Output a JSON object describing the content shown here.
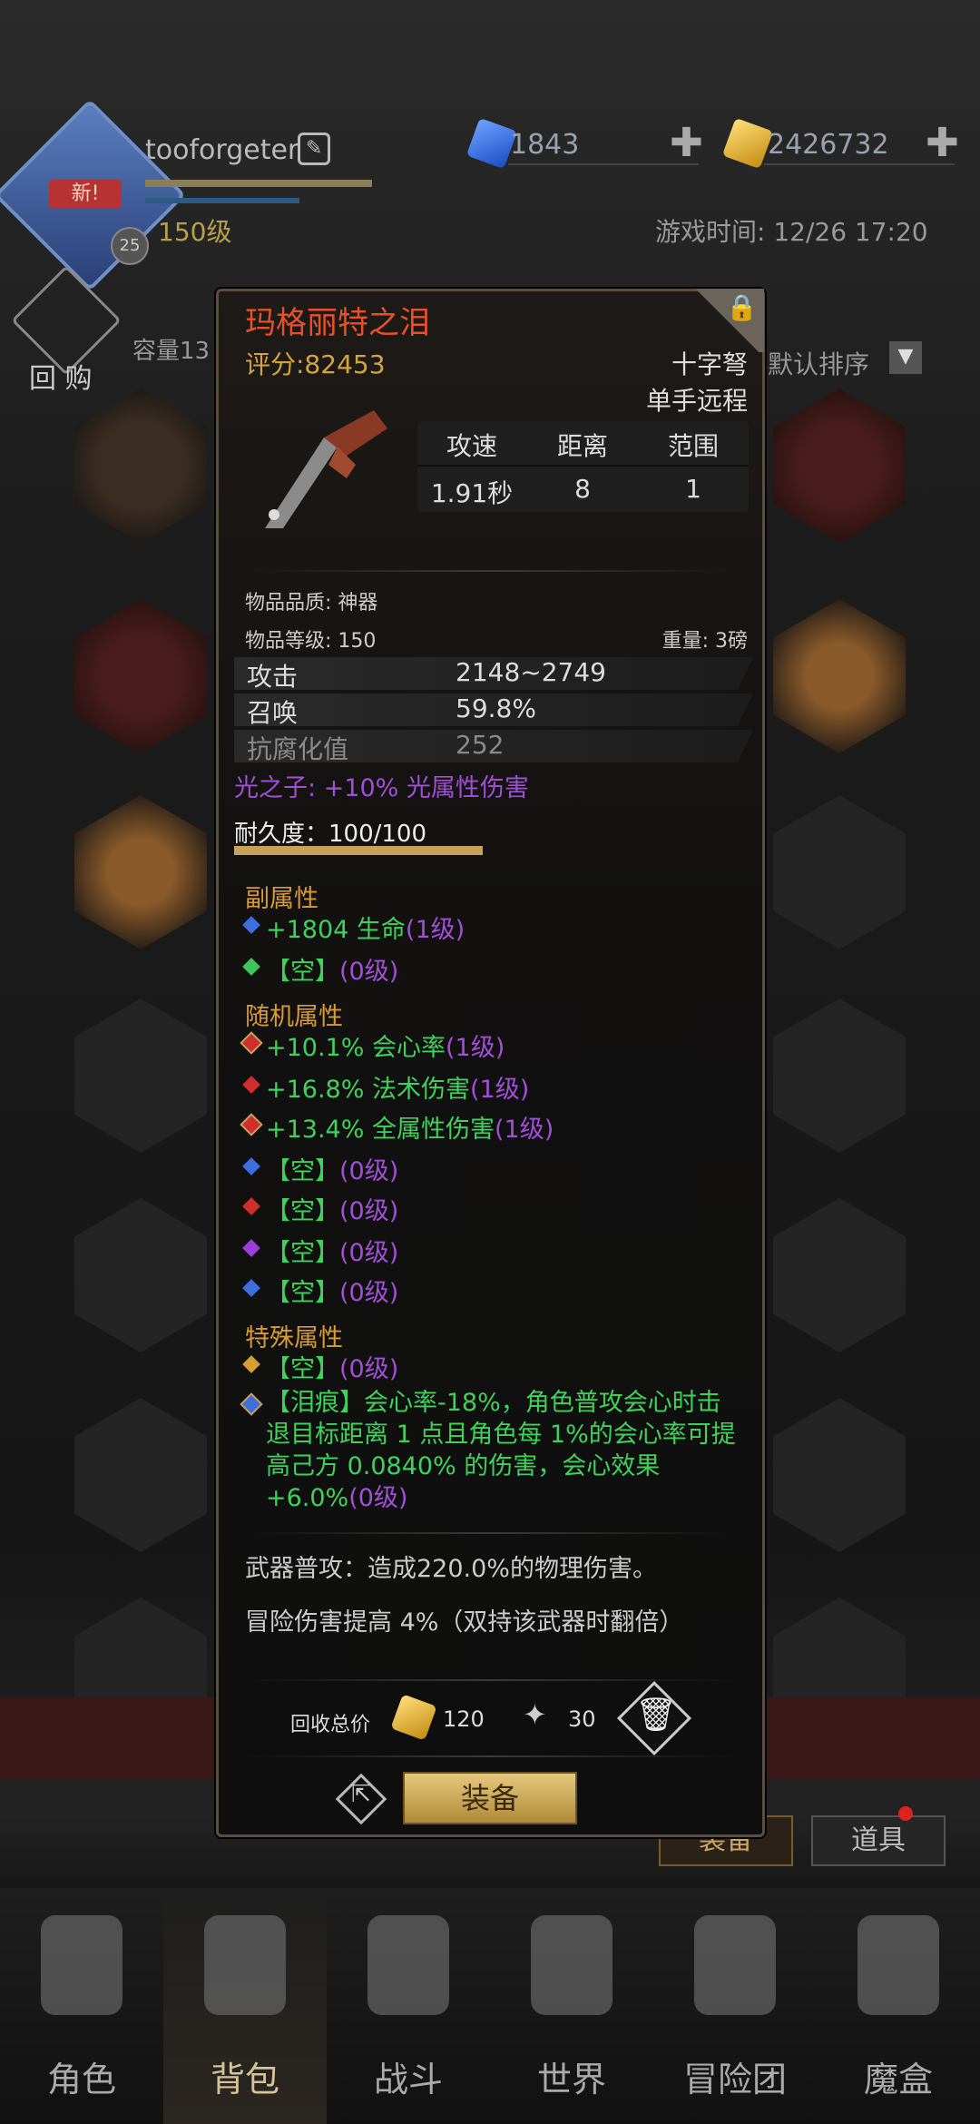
{
  "header": {
    "new_badge": "新!",
    "avatar_badge": "25",
    "username": "tooforgeter",
    "player_level": "150级",
    "blue_gems": "1843",
    "gold": "2426732",
    "game_time": "游戏时间: 12/26 17:20"
  },
  "inventory": {
    "buyback_label": "回 购",
    "capacity": "容量13",
    "sort_label": "默认排序",
    "equip_tab": "装备",
    "items_tab": "道具"
  },
  "item": {
    "name": "玛格丽特之泪",
    "score": "评分:82453",
    "weapon_type": "十字弩",
    "weapon_class": "单手远程",
    "stats_headers": [
      "攻速",
      "距离",
      "范围"
    ],
    "stats_values": [
      "1.91秒",
      "8",
      "1"
    ],
    "quality": "物品品质: 神器",
    "item_level": "物品等级: 150",
    "weight": "重量: 3磅",
    "base_stats": [
      {
        "label": "攻击",
        "value": "2148~2749"
      },
      {
        "label": "召唤",
        "value": "59.8%"
      },
      {
        "label": "抗腐化值",
        "value": "252"
      }
    ],
    "set_bonus": "光之子: +10% 光属性伤害",
    "durability": "耐久度：100/100",
    "durability_fraction": 1.0,
    "secondary_title": "副属性",
    "secondary": [
      {
        "text": "+1804 生命",
        "level": "(1级)",
        "gem_color": "#3c6ee0"
      },
      {
        "text": "【空】",
        "level": "(0级)",
        "gem_color": "#3fc45a"
      }
    ],
    "random_title": "随机属性",
    "random": [
      {
        "text": "+10.1% 会心率",
        "level": "(1级)",
        "gem_color": "#d22d2d"
      },
      {
        "text": "+16.8% 法术伤害",
        "level": "(1级)",
        "gem_color": "#d22d2d"
      },
      {
        "text": "+13.4% 全属性伤害",
        "level": "(1级)",
        "gem_color": "#d22d2d"
      },
      {
        "text": "【空】",
        "level": "(0级)",
        "gem_color": "#3c6ee0"
      },
      {
        "text": "【空】",
        "level": "(0级)",
        "gem_color": "#d22d2d"
      },
      {
        "text": "【空】",
        "level": "(0级)",
        "gem_color": "#9b3fd8"
      },
      {
        "text": "【空】",
        "level": "(0级)",
        "gem_color": "#3c6ee0"
      }
    ],
    "special_title": "特殊属性",
    "special_empty_text": "【空】",
    "special_empty_level": "(0级)",
    "special_tear_text": "【泪痕】会心率-18%，角色普攻会心时击退目标距离 1 点且角色每 1%的会心率可提高己方 0.0840% 的伤害，会心效果+6.0%",
    "special_tear_level": "(0级)",
    "desc_attack": "武器普攻：造成220.0%的物理伤害。",
    "desc_adventure": "冒险伤害提高 4%（双持该武器时翻倍）",
    "recycle_label": "回收总价",
    "recycle_gold": "120",
    "recycle_dust": "30",
    "equip_button": "装备"
  },
  "nav": [
    {
      "label": "角色",
      "icon": "helmet-icon"
    },
    {
      "label": "背包",
      "icon": "backpack-icon"
    },
    {
      "label": "战斗",
      "icon": "swords-icon"
    },
    {
      "label": "世界",
      "icon": "map-icon"
    },
    {
      "label": "冒险团",
      "icon": "castle-icon"
    },
    {
      "label": "魔盒",
      "icon": "magic-box-icon"
    }
  ],
  "nav_active": 1
}
